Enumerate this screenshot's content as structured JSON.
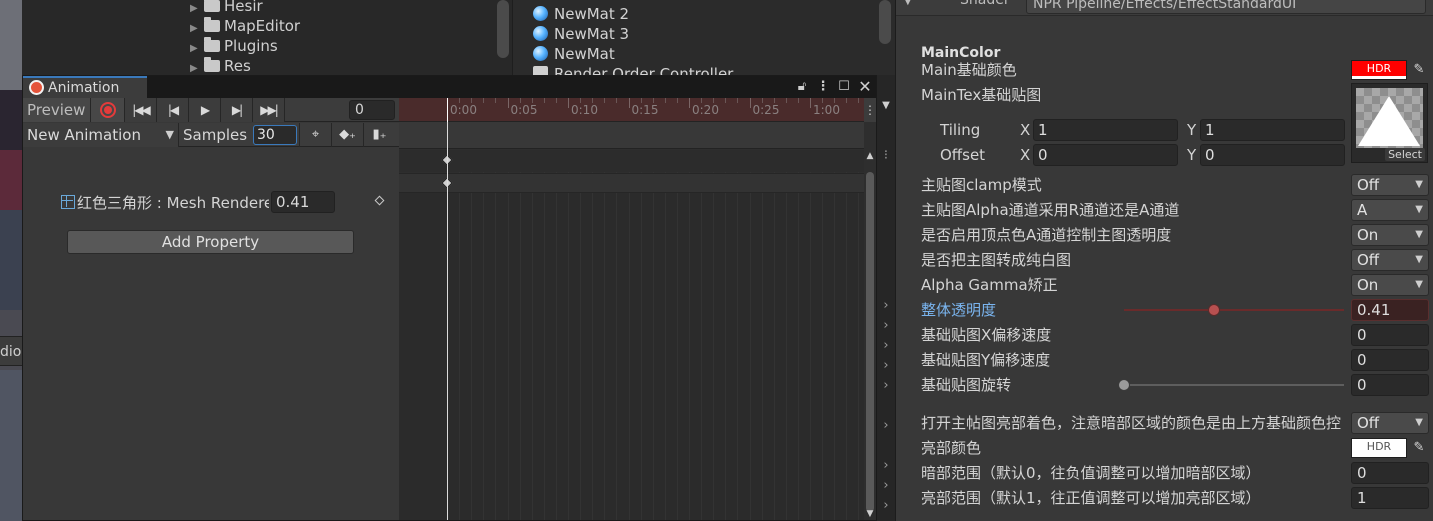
{
  "scene_view": {
    "audio_label": "dio"
  },
  "project_tree": {
    "folders": [
      {
        "label": "Hesir"
      },
      {
        "label": "MapEditor"
      },
      {
        "label": "Plugins"
      },
      {
        "label": "Res"
      }
    ]
  },
  "materials": {
    "items": [
      {
        "label": "NewMat 2"
      },
      {
        "label": "NewMat 3"
      },
      {
        "label": "NewMat"
      },
      {
        "label": "Render Order Controller"
      }
    ]
  },
  "animation": {
    "tab_title": "Animation",
    "preview_label": "Preview",
    "frame_value": "0",
    "clip_name": "New Animation",
    "samples_label": "Samples",
    "samples_value": "30",
    "property_label": "红色三角形 : Mesh Rendere",
    "property_value": "0.41",
    "add_property_label": "Add Property",
    "timeline_ticks": [
      "0:00",
      "0:05",
      "0:10",
      "0:15",
      "0:20",
      "0:25",
      "1:00"
    ]
  },
  "inspector": {
    "shader_label": "Shader",
    "shader_value": "NPR Pipeline/Effects/EffectStandardUI",
    "section_title": "MainColor",
    "main_color_label": "Main基础颜色",
    "main_color": "#ff0000",
    "hdr_label": "HDR",
    "main_tex_label": "MainTex基础贴图",
    "select_label": "Select",
    "tiling_label": "Tiling",
    "offset_label": "Offset",
    "x_label": "X",
    "y_label": "Y",
    "tiling_x": "1",
    "tiling_y": "1",
    "offset_x": "0",
    "offset_y": "0",
    "rows": [
      {
        "label": "主贴图clamp模式",
        "value": "Off"
      },
      {
        "label": "主贴图Alpha通道采用R通道还是A通道",
        "value": "A"
      },
      {
        "label": "是否启用顶点色A通道控制主图透明度",
        "value": "On"
      },
      {
        "label": "是否把主图转成纯白图",
        "value": "Off"
      },
      {
        "label": "Alpha Gamma矫正",
        "value": "On"
      }
    ],
    "opacity_label": "整体透明度",
    "opacity_value": "0.41",
    "opacity_fraction": 0.41,
    "offset_x_speed_label": "基础贴图X偏移速度",
    "offset_x_speed_value": "0",
    "offset_y_speed_label": "基础贴图Y偏移速度",
    "offset_y_speed_value": "0",
    "rotation_label": "基础贴图旋转",
    "rotation_value": "0",
    "rotation_fraction": 0,
    "bright_tint_label": "打开主帖图亮部着色，注意暗部区域的颜色是由上方基础颜色控",
    "bright_tint_value": "Off",
    "bright_color_label": "亮部颜色",
    "bright_color": "#ffffff",
    "dark_range_label": "暗部范围（默认0，往负值调整可以增加暗部区域）",
    "dark_range_value": "0",
    "bright_range_label": "亮部范围（默认1，往正值调整可以增加亮部区域）",
    "bright_range_value": "1"
  }
}
